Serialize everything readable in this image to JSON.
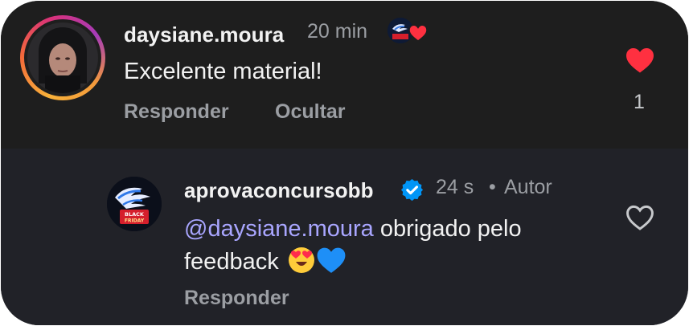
{
  "comment": {
    "username": "daysiane.moura",
    "time": "20 min",
    "text": "Excelente material!",
    "actions": {
      "reply": "Responder",
      "hide": "Ocultar"
    },
    "like_count": "1",
    "liked": true,
    "creator_liked_badge": "BLACK FRIDAY"
  },
  "reply": {
    "username": "aprovaconcursobb",
    "verified": true,
    "time": "24 s",
    "separator": "•",
    "author_label": "Autor",
    "mention": "@daysiane.moura",
    "text": "obrigado pelo feedback",
    "emojis": [
      "heart-eyes-emoji",
      "blue-heart-emoji"
    ],
    "avatar_text": "BLACK FRIDAY",
    "actions": {
      "reply": "Responder"
    }
  },
  "colors": {
    "like_red": "#ff3040",
    "verified_blue": "#0095f6",
    "mention": "#a9a6ff"
  }
}
